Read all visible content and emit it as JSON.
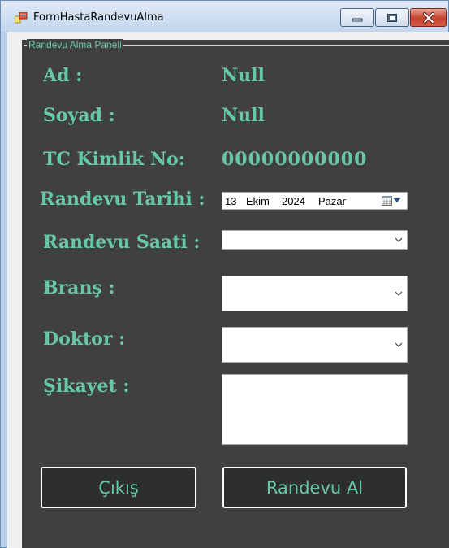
{
  "window": {
    "title": "FormHastaRandevuAlma",
    "app_icon": "winforms-app-icon",
    "controls": {
      "minimize_icon": "minimize-icon",
      "maximize_icon": "maximize-icon",
      "close_icon": "close-icon"
    }
  },
  "panel": {
    "legend": "Randevu Alma Paneli"
  },
  "labels": {
    "ad": "Ad :",
    "soyad": "Soyad :",
    "tc": "TC Kimlik No:",
    "tarih": "Randevu Tarihi :",
    "saat": "Randevu Saati :",
    "brans": "Branş :",
    "doktor": "Doktor :",
    "sikayet": "Şikayet :"
  },
  "values": {
    "ad": "Null",
    "soyad": "Null",
    "tc": "00000000000"
  },
  "date_picker": {
    "day": "13",
    "month": "Ekim",
    "year": "2024",
    "weekday": "Pazar",
    "icon": "calendar-icon"
  },
  "inputs": {
    "saat_value": "",
    "brans_value": "",
    "doktor_value": "",
    "sikayet_value": ""
  },
  "buttons": {
    "exit": "Çıkış",
    "book": "Randevu Al"
  },
  "colors": {
    "panel_bg": "#404040",
    "accent_text": "#66c8a6",
    "button_bg": "#2e2e2e",
    "button_border": "#ffffff"
  }
}
